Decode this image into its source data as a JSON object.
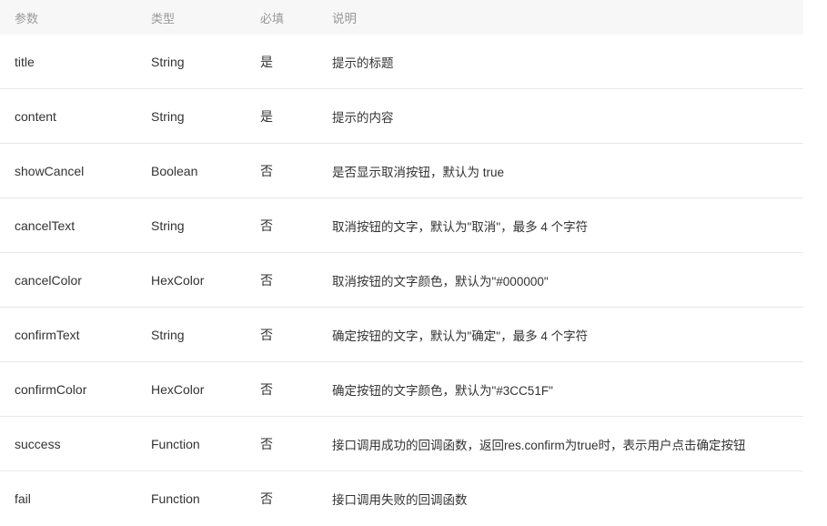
{
  "table": {
    "headers": {
      "param": "参数",
      "type": "类型",
      "required": "必填",
      "desc": "说明"
    },
    "rows": [
      {
        "param": "title",
        "type": "String",
        "required": "是",
        "desc": "提示的标题"
      },
      {
        "param": "content",
        "type": "String",
        "required": "是",
        "desc": "提示的内容"
      },
      {
        "param": "showCancel",
        "type": "Boolean",
        "required": "否",
        "desc": "是否显示取消按钮，默认为 true"
      },
      {
        "param": "cancelText",
        "type": "String",
        "required": "否",
        "desc": "取消按钮的文字，默认为\"取消\"，最多 4 个字符"
      },
      {
        "param": "cancelColor",
        "type": "HexColor",
        "required": "否",
        "desc": "取消按钮的文字颜色，默认为\"#000000\""
      },
      {
        "param": "confirmText",
        "type": "String",
        "required": "否",
        "desc": "确定按钮的文字，默认为\"确定\"，最多 4 个字符"
      },
      {
        "param": "confirmColor",
        "type": "HexColor",
        "required": "否",
        "desc": "确定按钮的文字颜色，默认为\"#3CC51F\""
      },
      {
        "param": "success",
        "type": "Function",
        "required": "否",
        "desc": "接口调用成功的回调函数，返回res.confirm为true时，表示用户点击确定按钮"
      },
      {
        "param": "fail",
        "type": "Function",
        "required": "否",
        "desc": "接口调用失败的回调函数"
      }
    ]
  }
}
